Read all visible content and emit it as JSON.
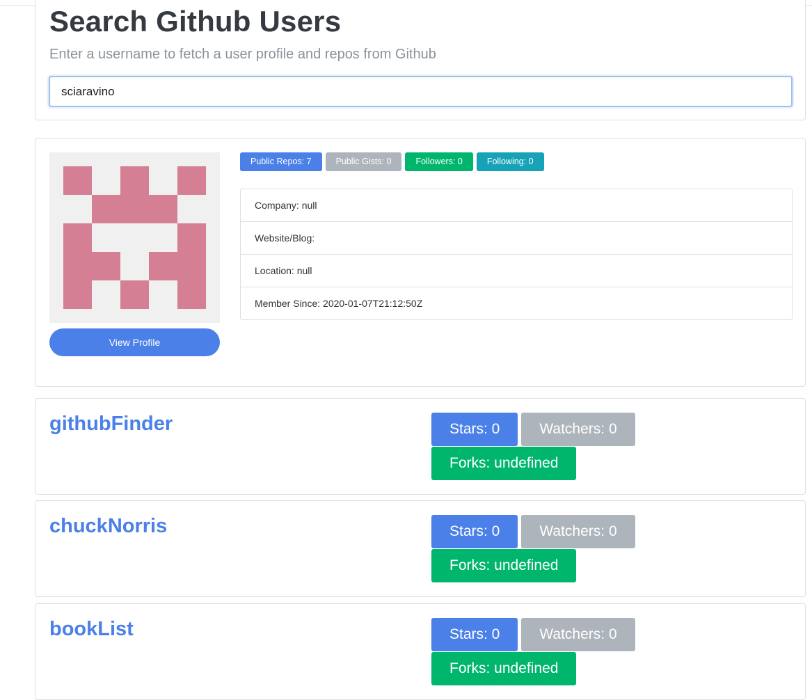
{
  "header": {
    "title": "Search Github Users",
    "subtitle": "Enter a username to fetch a user profile and repos from Github"
  },
  "search": {
    "value": "sciaravino",
    "placeholder": ""
  },
  "profile": {
    "avatar_color": "#d47f93",
    "view_profile_label": "View Profile",
    "badges": {
      "public_repos": "Public Repos: 7",
      "public_gists": "Public Gists: 0",
      "followers": "Followers: 0",
      "following": "Following: 0"
    },
    "details": {
      "company": "Company: null",
      "website": "Website/Blog:",
      "location": "Location: null",
      "member_since": "Member Since: 2020-01-07T21:12:50Z"
    }
  },
  "repos": [
    {
      "name": "githubFinder",
      "stars": "Stars: 0",
      "watchers": "Watchers: 0",
      "forks": "Forks: undefined"
    },
    {
      "name": "chuckNorris",
      "stars": "Stars: 0",
      "watchers": "Watchers: 0",
      "forks": "Forks: undefined"
    },
    {
      "name": "bookList",
      "stars": "Stars: 0",
      "watchers": "Watchers: 0",
      "forks": "Forks: undefined"
    }
  ],
  "colors": {
    "primary": "#4a80e8",
    "secondary": "#aeb4bb",
    "success": "#00b66d",
    "info": "#17a2b8"
  }
}
